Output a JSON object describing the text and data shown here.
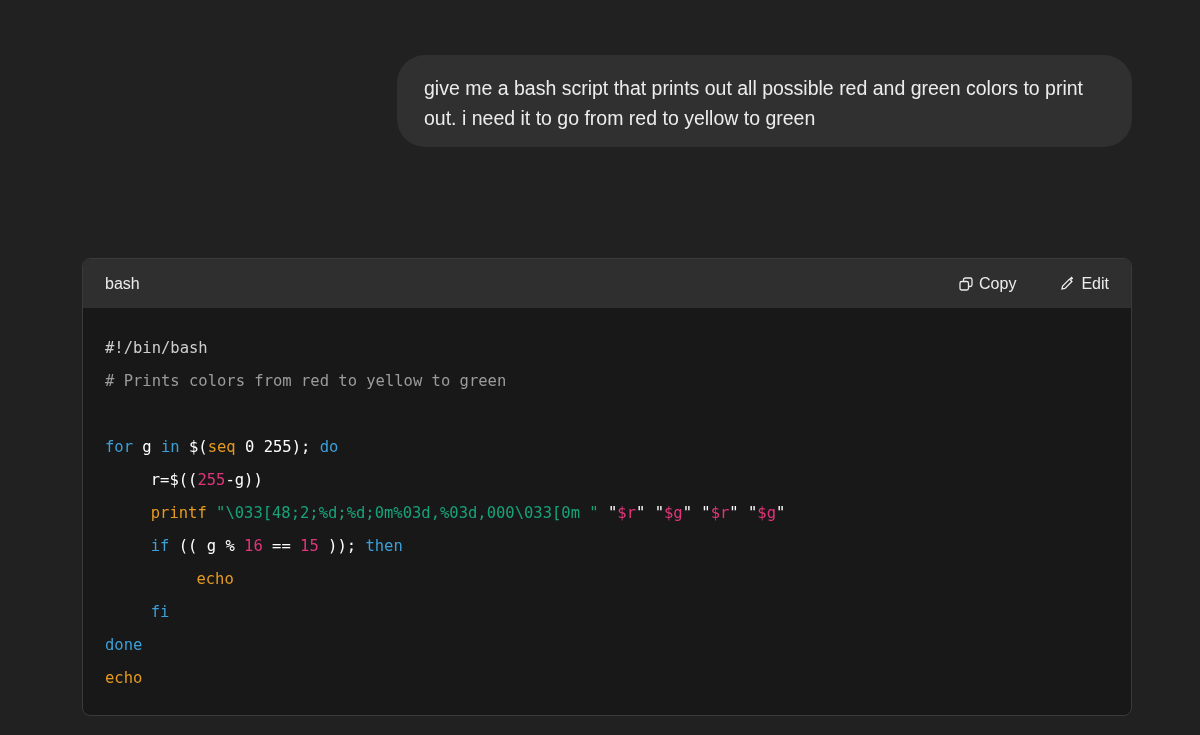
{
  "message": {
    "text": "give me a bash script that prints out all possible red and green colors to print out. i need it to go from red to yellow to green"
  },
  "code_block": {
    "language": "bash",
    "actions": [
      {
        "kind": "copy",
        "label": "Copy"
      },
      {
        "kind": "edit",
        "label": "Edit"
      }
    ],
    "lines": [
      {
        "tokens": [
          {
            "kind": "shebang",
            "text": "#!/bin/bash"
          }
        ]
      },
      {
        "tokens": [
          {
            "kind": "comment",
            "text": "# Prints colors from red to yellow to green"
          }
        ]
      },
      {
        "kind": "blank"
      },
      {
        "tokens": [
          {
            "kind": "keyword",
            "text": "for"
          },
          {
            "kind": "plain",
            "text": " g "
          },
          {
            "kind": "keyword",
            "text": "in"
          },
          {
            "kind": "plain",
            "text": " $("
          },
          {
            "kind": "builtin",
            "text": "seq"
          },
          {
            "kind": "plain",
            "text": " 0 255); "
          },
          {
            "kind": "keyword",
            "text": "do"
          }
        ],
        "children": [
          {
            "tokens": [
              {
                "kind": "plain",
                "text": "r=$(("
              },
              {
                "kind": "number",
                "text": "255"
              },
              {
                "kind": "plain",
                "text": "-g))"
              }
            ]
          },
          {
            "tokens": [
              {
                "kind": "builtin",
                "text": "printf"
              },
              {
                "kind": "string",
                "text": " \"\\033[48;2;%d;%d;0m%03d,%03d,000\\033[0m \""
              },
              {
                "kind": "plain",
                "text": " \""
              },
              {
                "kind": "variable",
                "text": "$r"
              },
              {
                "kind": "plain",
                "text": "\" \""
              },
              {
                "kind": "variable",
                "text": "$g"
              },
              {
                "kind": "plain",
                "text": "\" \""
              },
              {
                "kind": "variable",
                "text": "$r"
              },
              {
                "kind": "plain",
                "text": "\" \""
              },
              {
                "kind": "variable",
                "text": "$g"
              },
              {
                "kind": "plain",
                "text": "\""
              }
            ]
          },
          {
            "tokens": [
              {
                "kind": "keyword",
                "text": "if"
              },
              {
                "kind": "plain",
                "text": " (( g % "
              },
              {
                "kind": "number",
                "text": "16"
              },
              {
                "kind": "plain",
                "text": " == "
              },
              {
                "kind": "number",
                "text": "15"
              },
              {
                "kind": "plain",
                "text": " )); "
              },
              {
                "kind": "keyword",
                "text": "then"
              }
            ],
            "children": [
              {
                "tokens": [
                  {
                    "kind": "builtin",
                    "text": "echo"
                  }
                ]
              }
            ]
          },
          {
            "tokens": [
              {
                "kind": "keyword",
                "text": "fi"
              }
            ]
          }
        ]
      },
      {
        "tokens": [
          {
            "kind": "keyword",
            "text": "done"
          }
        ]
      },
      {
        "tokens": [
          {
            "kind": "builtin",
            "text": "echo"
          }
        ]
      }
    ]
  }
}
